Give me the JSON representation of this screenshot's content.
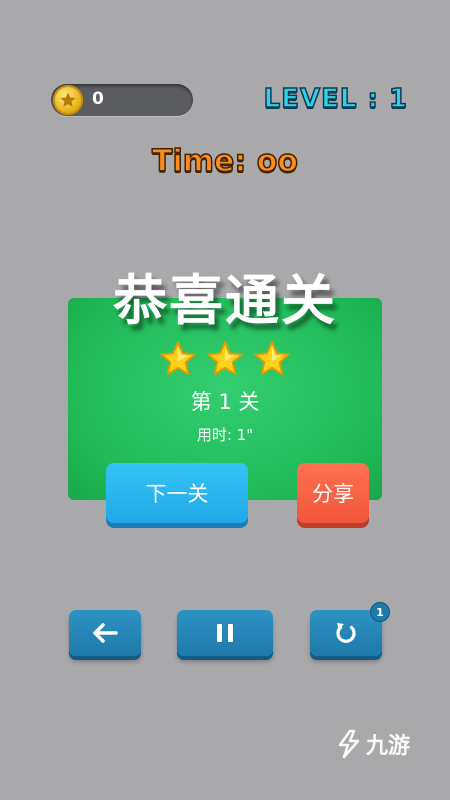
{
  "hud": {
    "coins": "0",
    "level": "LEVEL : 1",
    "timer": "Time: oo"
  },
  "result": {
    "title": "恭喜通关",
    "stars_earned": 3,
    "stars_total": 3,
    "stage_label": "第 1 关",
    "time_used": "用时: 1\"",
    "next_button": "下一关",
    "share_button": "分享"
  },
  "controls": {
    "back_icon": "arrow-left-icon",
    "pause_icon": "pause-icon",
    "restart_icon": "restart-icon",
    "restart_badge": "1"
  },
  "watermark": {
    "text": "九游"
  },
  "colors": {
    "background": "#a9a8ab",
    "card": "#22bb5a",
    "next_button": "#27b1ee",
    "share_button": "#f45c40",
    "control_button": "#2386b7",
    "level_text": "#31d0e3",
    "timer_text": "#ff8a1e",
    "star": "#ffd21a"
  }
}
